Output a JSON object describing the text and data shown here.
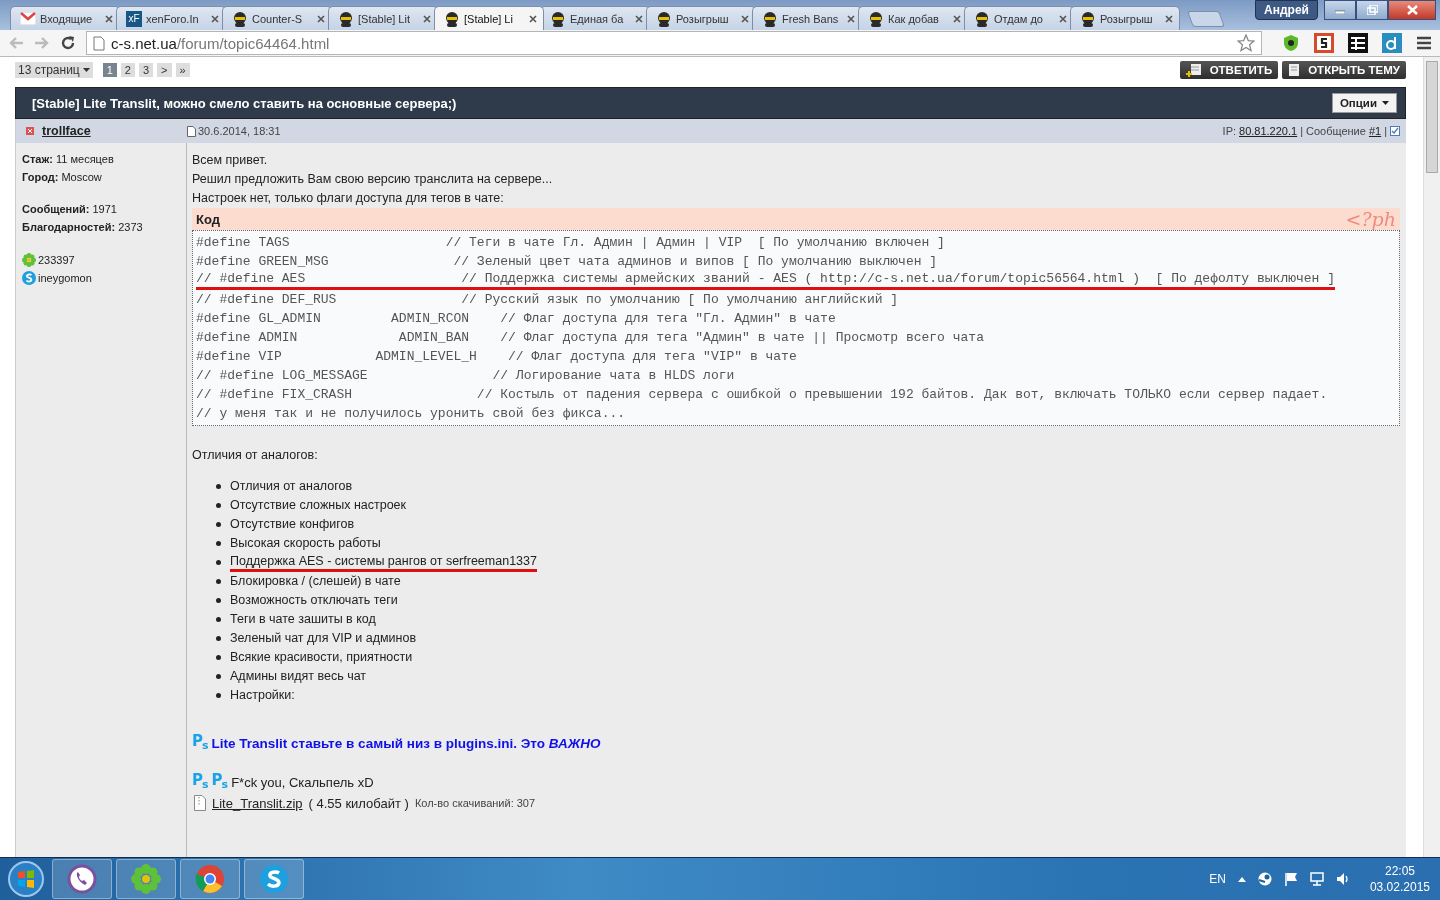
{
  "tabs": [
    {
      "label": "Входящие",
      "kind": "mail",
      "selected": false
    },
    {
      "label": "xenForo.In",
      "kind": "logo",
      "logo": "xF",
      "selected": false
    },
    {
      "label": "Counter-S",
      "kind": "site",
      "selected": false
    },
    {
      "label": "[Stable] Lit",
      "kind": "site",
      "selected": false
    },
    {
      "label": "[Stable] Li",
      "kind": "site",
      "selected": true
    },
    {
      "label": "Единая ба",
      "kind": "site",
      "selected": false
    },
    {
      "label": "Розыгрыш",
      "kind": "site",
      "selected": false
    },
    {
      "label": "Fresh Bans",
      "kind": "site",
      "selected": false
    },
    {
      "label": "Как добав",
      "kind": "site",
      "selected": false
    },
    {
      "label": "Отдам до",
      "kind": "site",
      "selected": false
    },
    {
      "label": "Розыгрыш",
      "kind": "site",
      "selected": false
    }
  ],
  "window": {
    "user": "Андрей"
  },
  "address": {
    "host": "c-s.net.ua",
    "path": "/forum/topic64464.html"
  },
  "pagination": {
    "label": "13 страниц",
    "pages": [
      {
        "label": "1",
        "selected": true
      },
      {
        "label": "2",
        "selected": false
      },
      {
        "label": "3",
        "selected": false
      },
      {
        "label": ">",
        "selected": false
      },
      {
        "label": "»",
        "selected": false
      }
    ]
  },
  "actions": [
    {
      "label": "ОТВЕТИТЬ",
      "kind": "reply"
    },
    {
      "label": "ОТКРЫТЬ ТЕМУ",
      "kind": "new"
    }
  ],
  "topic": {
    "title": "[Stable] Lite Translit, можно смело ставить на основные сервера;)",
    "options": "Опции"
  },
  "post": {
    "author": "trollface",
    "date": "30.6.2014, 18:31",
    "meta": [
      {
        "kind": "label",
        "text": "IP:"
      },
      {
        "kind": "link",
        "text": "80.81.220.1"
      },
      {
        "kind": "separator",
        "text": "|"
      },
      {
        "kind": "label",
        "text": "Сообщение"
      },
      {
        "kind": "link",
        "text": "#1"
      },
      {
        "kind": "separator",
        "text": "|"
      },
      {
        "kind": "checkbox"
      }
    ],
    "profile": [
      [
        {
          "label": "Стаж:",
          "value": "11 месяцев"
        },
        {
          "label": "Город:",
          "value": "Moscow"
        }
      ],
      [
        {
          "label": "Сообщений:",
          "value": "1971"
        },
        {
          "label": "Благодарностей:",
          "value": "2373"
        }
      ]
    ],
    "contacts": [
      {
        "kind": "icq",
        "text": "233397"
      },
      {
        "kind": "skype",
        "text": "ineygomon"
      }
    ],
    "intro": [
      "Всем привет.",
      "Решил предложить Вам свою версию транслита на сервере...",
      "Настроек нет, только флаги доступа для тегов в чате:"
    ],
    "code": {
      "title": "Код",
      "language": "<?ph",
      "lines": [
        {
          "text": "#define TAGS                    // Теги в чате Гл. Админ | Админ | VIP  [ По умолчанию включен ]",
          "marked": false
        },
        {
          "text": "#define GREEN_MSG                // Зеленый цвет чата админов и випов [ По умолчанию выключен ]",
          "marked": false
        },
        {
          "text": "// #define AES                    // Поддержка системы армейских званий - AES ( http://c-s.net.ua/forum/topic56564.html )  [ По дефолту выключен ]",
          "marked": true
        },
        {
          "text": "// #define DEF_RUS                // Русский язык по умолчанию [ По умолчанию английский ]",
          "marked": false
        },
        {
          "text": "#define GL_ADMIN         ADMIN_RCON    // Флаг доступа для тега \"Гл. Админ\" в чате",
          "marked": false
        },
        {
          "text": "#define ADMIN             ADMIN_BAN    // Флаг доступа для тега \"Админ\" в чате || Просмотр всего чата",
          "marked": false
        },
        {
          "text": "#define VIP            ADMIN_LEVEL_H    // Флаг доступа для тега \"VIP\" в чате",
          "marked": false
        },
        {
          "text": "// #define LOG_MESSAGE                // Логирование чата в HLDS логи",
          "marked": false
        },
        {
          "text": "// #define FIX_CRASH                // Костыль от падения сервера с ошибкой о превышении 192 байтов. Дак вот, включать ТОЛЬКО если сервер падает.",
          "marked": false
        },
        {
          "text": "// у меня так и не получилось уронить свой без фикса...",
          "marked": false
        }
      ]
    },
    "list_title": "Отличия от аналогов:",
    "features": [
      {
        "text": "Отличия от аналогов",
        "marked": false
      },
      {
        "text": "Отсутствие сложных настроек",
        "marked": false
      },
      {
        "text": "Отсутствие конфигов",
        "marked": false
      },
      {
        "text": "Высокая скорость работы",
        "marked": false
      },
      {
        "text": "Поддержка AES - системы рангов от serfreeman1337",
        "marked": true
      },
      {
        "text": "Блокировка / (слешей) в чате",
        "marked": false
      },
      {
        "text": "Возможность отключать теги",
        "marked": false
      },
      {
        "text": "Теги в чате зашиты в код",
        "marked": false
      },
      {
        "text": "Зеленый чат для VIP и админов",
        "marked": false
      },
      {
        "text": "Всякие красивости, приятности",
        "marked": false
      },
      {
        "text": "Админы видят весь чат",
        "marked": false
      },
      {
        "text": "Настройки:",
        "marked": false
      }
    ],
    "notice": {
      "emoticons": [
        "P$_{s}$"
      ],
      "text": "Lite Translit ставьте в самый низ в plugins.ini. Это *ВАЖНО*"
    },
    "signature": {
      "emoticons": [
        "P$_{s}$",
        "P$_{s}$"
      ],
      "text": "F*ck you, Скальпель xD"
    },
    "attachment": {
      "name": "Lite_Translit.zip",
      "size": "( 4.55 килобайт )",
      "downloads": "Кол-во скачиваний: 307"
    }
  },
  "taskbar": {
    "apps": [
      {
        "kind": "viber"
      },
      {
        "kind": "icq"
      },
      {
        "kind": "chrome"
      },
      {
        "kind": "skype"
      }
    ],
    "language": "EN",
    "time": "22:05",
    "date": "03.02.2015"
  }
}
